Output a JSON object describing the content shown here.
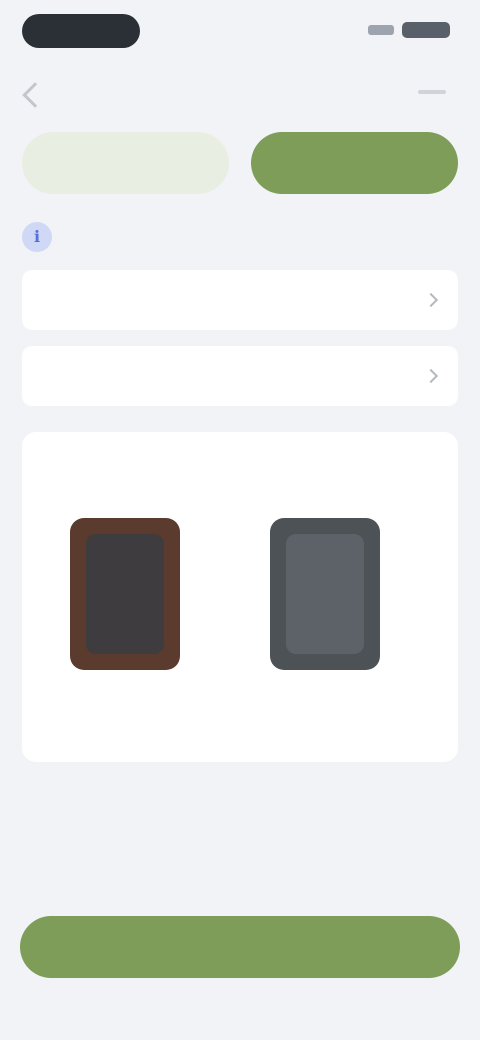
{
  "status_bar": {
    "time": "",
    "icons": [
      "signal-icon",
      "battery-icon"
    ]
  },
  "header": {
    "title": "",
    "back_icon": "back-arrow-icon",
    "menu_icon": "overflow-menu-icon"
  },
  "tabs": [
    {
      "label": "",
      "active": false
    },
    {
      "label": "",
      "active": true
    }
  ],
  "info": {
    "icon": "info-icon",
    "text": ""
  },
  "fields": [
    {
      "label": "",
      "value": ""
    },
    {
      "label": "",
      "value": ""
    }
  ],
  "recommendations": {
    "title": "",
    "more_link": "",
    "products": [
      {
        "name": "",
        "image": "brown-case-image"
      },
      {
        "name": "",
        "image": "gray-case-image"
      }
    ]
  },
  "summary": {
    "section_title": "",
    "label": "",
    "value": ""
  },
  "cta": {
    "label": ""
  },
  "colors": {
    "accent": "#7e9d59",
    "accent_light": "#e9eee3",
    "background": "#f1f3f6",
    "card": "#ffffff",
    "info_accent": "#5670d6"
  }
}
